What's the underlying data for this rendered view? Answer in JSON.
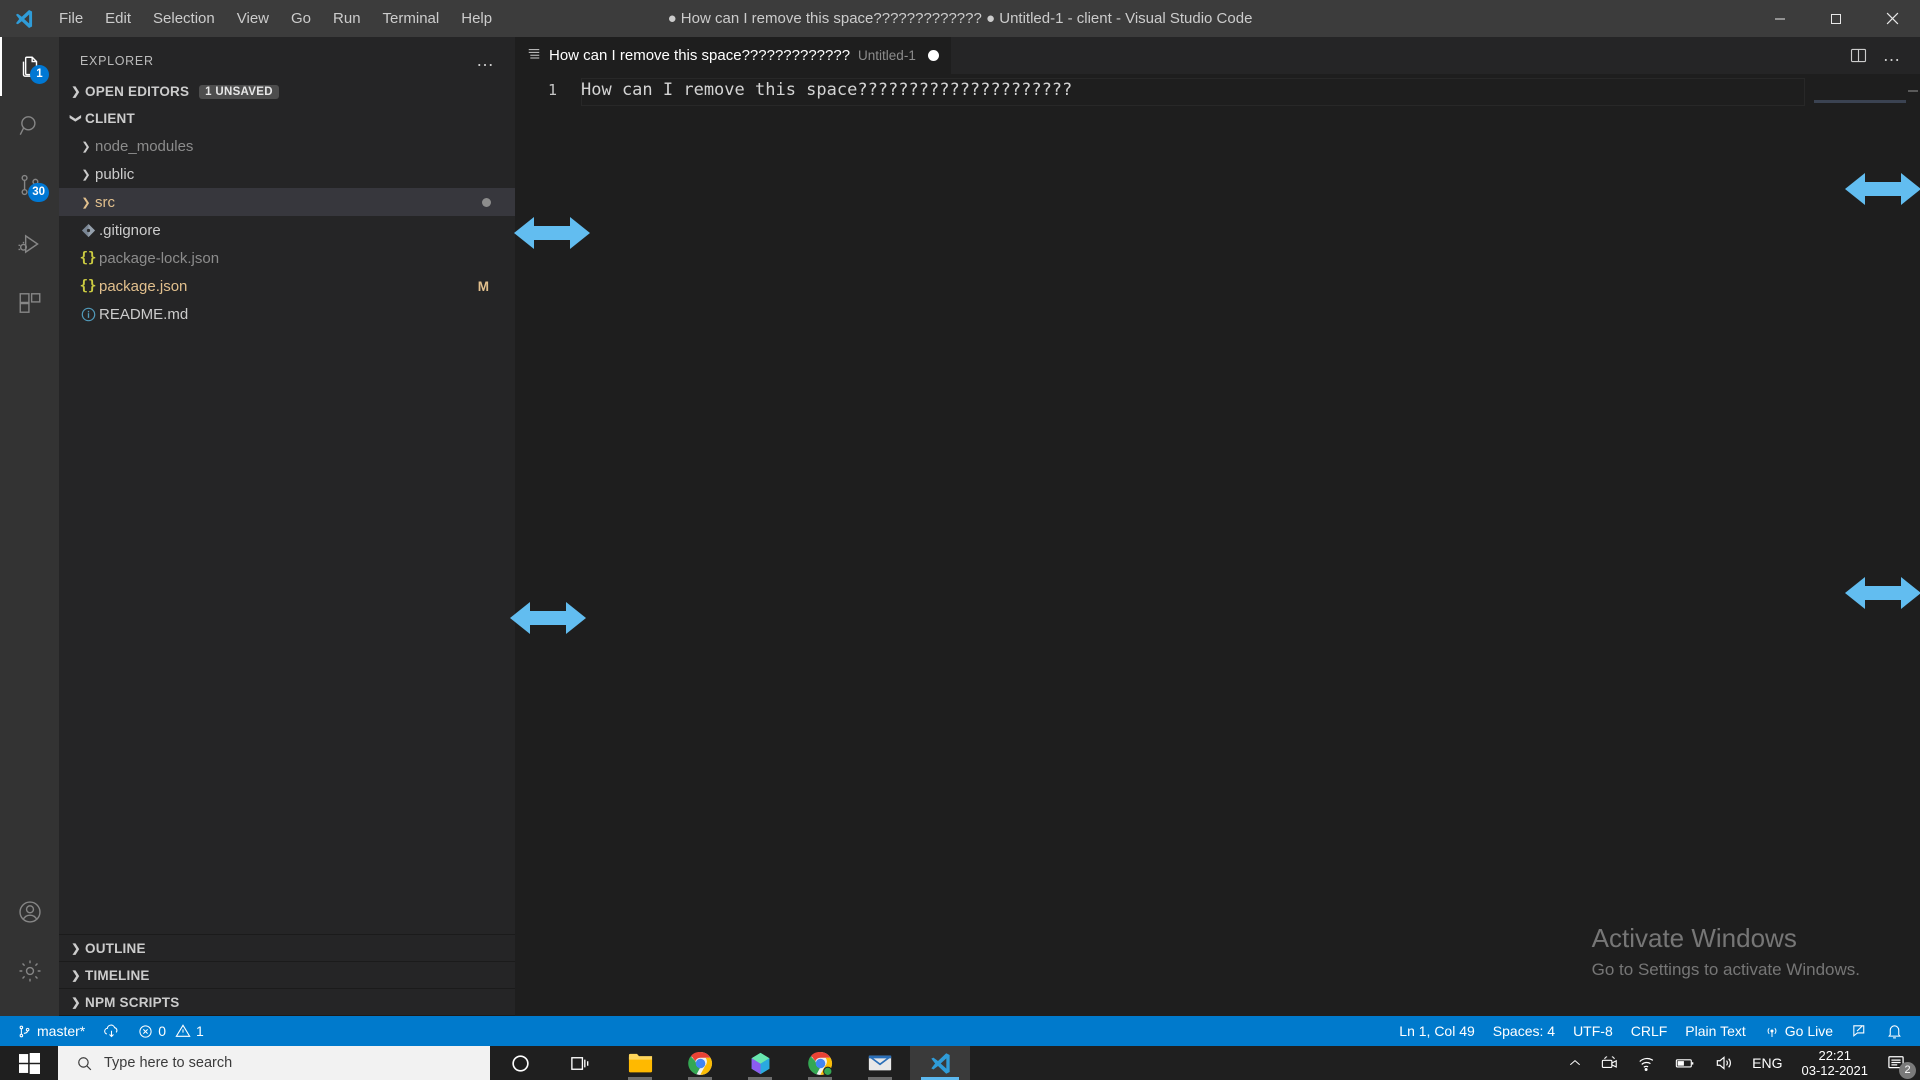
{
  "window": {
    "title": "● How can I remove this space????????????? ● Untitled-1 - client - Visual Studio Code",
    "minimize_label": "–",
    "maximize_label": "□",
    "close_label": "✕"
  },
  "menubar": {
    "items": [
      "File",
      "Edit",
      "Selection",
      "View",
      "Go",
      "Run",
      "Terminal",
      "Help"
    ]
  },
  "activitybar": {
    "items": [
      {
        "name": "explorer",
        "icon": "files-icon",
        "badge": "1",
        "active": true
      },
      {
        "name": "search",
        "icon": "search-icon",
        "badge": "",
        "active": false
      },
      {
        "name": "source-control",
        "icon": "source-control-icon",
        "badge": "30",
        "active": false
      },
      {
        "name": "run-and-debug",
        "icon": "run-debug-icon",
        "badge": "",
        "active": false
      },
      {
        "name": "extensions",
        "icon": "extensions-icon",
        "badge": "",
        "active": false
      }
    ],
    "bottom": [
      {
        "name": "accounts",
        "icon": "account-icon"
      },
      {
        "name": "manage",
        "icon": "gear-icon"
      }
    ]
  },
  "sidebar": {
    "header_title": "EXPLORER",
    "more_actions": "…",
    "open_editors": {
      "label": "OPEN EDITORS",
      "badge": "1 UNSAVED",
      "expanded": false
    },
    "workspace": {
      "label": "CLIENT",
      "expanded": true
    },
    "tree": [
      {
        "label": "node_modules",
        "type": "folder",
        "icon": "chevron-right-icon",
        "state": "dim",
        "marker": "",
        "selected": false
      },
      {
        "label": "public",
        "type": "folder",
        "icon": "chevron-right-icon",
        "state": "normal",
        "marker": "",
        "selected": false
      },
      {
        "label": "src",
        "type": "folder",
        "icon": "chevron-right-icon",
        "state": "mod",
        "marker": "dot",
        "selected": true
      },
      {
        "label": ".gitignore",
        "type": "file",
        "icon": "git-file-icon",
        "state": "normal",
        "marker": "",
        "selected": false
      },
      {
        "label": "package-lock.json",
        "type": "file",
        "icon": "json-icon",
        "state": "dim",
        "marker": "",
        "selected": false
      },
      {
        "label": "package.json",
        "type": "file",
        "icon": "json-icon",
        "state": "mod",
        "marker": "M",
        "selected": false
      },
      {
        "label": "README.md",
        "type": "file",
        "icon": "info-icon",
        "state": "normal",
        "marker": "",
        "selected": false
      }
    ],
    "bottom_sections": [
      {
        "label": "OUTLINE"
      },
      {
        "label": "TIMELINE"
      },
      {
        "label": "NPM SCRIPTS"
      }
    ]
  },
  "editor": {
    "tab": {
      "label": "How can I remove this space?????????????",
      "description": "Untitled-1",
      "dirty": true,
      "icon": "text-file-icon"
    },
    "tab_actions": {
      "split_editor": "split-editor-icon",
      "more_actions": "…"
    },
    "lines": [
      {
        "number": "1",
        "text": "How can I remove this space?????????????????????"
      }
    ]
  },
  "watermark": {
    "title": "Activate Windows",
    "subtitle": "Go to Settings to activate Windows."
  },
  "statusbar": {
    "left": [
      {
        "name": "branch",
        "icon": "source-control-icon",
        "text": "master*"
      },
      {
        "name": "sync",
        "icon": "sync-icon",
        "text": ""
      },
      {
        "name": "problems",
        "icon": "error-warning-icon",
        "text": "0  1",
        "errors": "0",
        "warnings": "1"
      }
    ],
    "right": [
      {
        "name": "cursor-position",
        "text": "Ln 1, Col 49"
      },
      {
        "name": "indentation",
        "text": "Spaces: 4"
      },
      {
        "name": "encoding",
        "text": "UTF-8"
      },
      {
        "name": "eol",
        "text": "CRLF"
      },
      {
        "name": "language-mode",
        "text": "Plain Text"
      },
      {
        "name": "go-live",
        "text": "Go Live",
        "icon": "broadcast-icon"
      },
      {
        "name": "feedback",
        "text": "",
        "icon": "feedback-icon"
      },
      {
        "name": "notifications",
        "text": "",
        "icon": "bell-icon"
      }
    ]
  },
  "taskbar": {
    "start": "windows-logo-icon",
    "search_placeholder": "Type here to search",
    "buttons": [
      {
        "name": "cortana",
        "icon": "cortana-icon"
      },
      {
        "name": "task-view",
        "icon": "task-view-icon"
      },
      {
        "name": "file-explorer",
        "icon": "file-explorer-icon",
        "state": "open"
      },
      {
        "name": "chrome",
        "icon": "chrome-icon",
        "state": "open"
      },
      {
        "name": "app-colorful",
        "icon": "photos-icon",
        "state": "open"
      },
      {
        "name": "chrome-2",
        "icon": "chrome-icon",
        "state": "open"
      },
      {
        "name": "mail",
        "icon": "mail-icon",
        "state": "open"
      },
      {
        "name": "vscode",
        "icon": "vscode-icon",
        "state": "active"
      }
    ],
    "tray": {
      "chevron": "chevron-up-icon",
      "icons": [
        "meet-now-icon",
        "network-icon",
        "battery-icon",
        "volume-icon"
      ],
      "language": "ENG",
      "time": "22:21",
      "date": "03-12-2021",
      "notification_count": "2"
    }
  },
  "colors": {
    "accent": "#007acc",
    "titlebar_bg": "#3c3c3c",
    "sidebar_bg": "#252526",
    "editor_bg": "#1e1e1e",
    "activitybar_bg": "#333333",
    "modified": "#e2c08d",
    "cursor_arrow": "#62bdf0"
  }
}
